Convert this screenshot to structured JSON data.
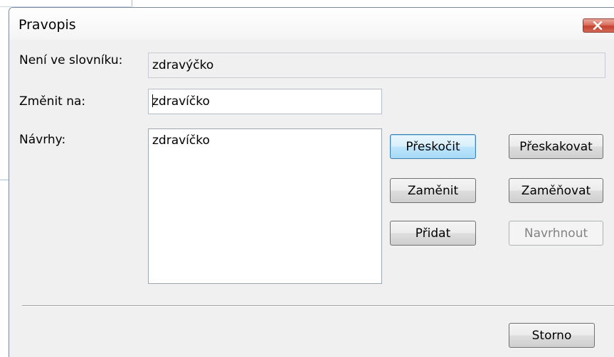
{
  "dialog": {
    "title": "Pravopis"
  },
  "fields": {
    "not_in_dictionary_label": "Není ve slovníku:",
    "not_in_dictionary_value": "zdravýčko",
    "change_to_label": "Změnit na:",
    "change_to_value": "zdravíčko",
    "suggestions_label": "Návrhy:",
    "suggestions": [
      "zdravíčko"
    ]
  },
  "buttons": {
    "skip": "Přeskočit",
    "skip_all": "Přeskakovat",
    "replace": "Zaměnit",
    "replace_all": "Zaměňovat",
    "add": "Přidat",
    "suggest": "Navrhnout",
    "cancel": "Storno"
  },
  "icons": {
    "close": "close-icon"
  },
  "colors": {
    "default_button": "#bee6fd",
    "close_button": "#c6412e",
    "dialog_background": "#f0f0f0"
  }
}
